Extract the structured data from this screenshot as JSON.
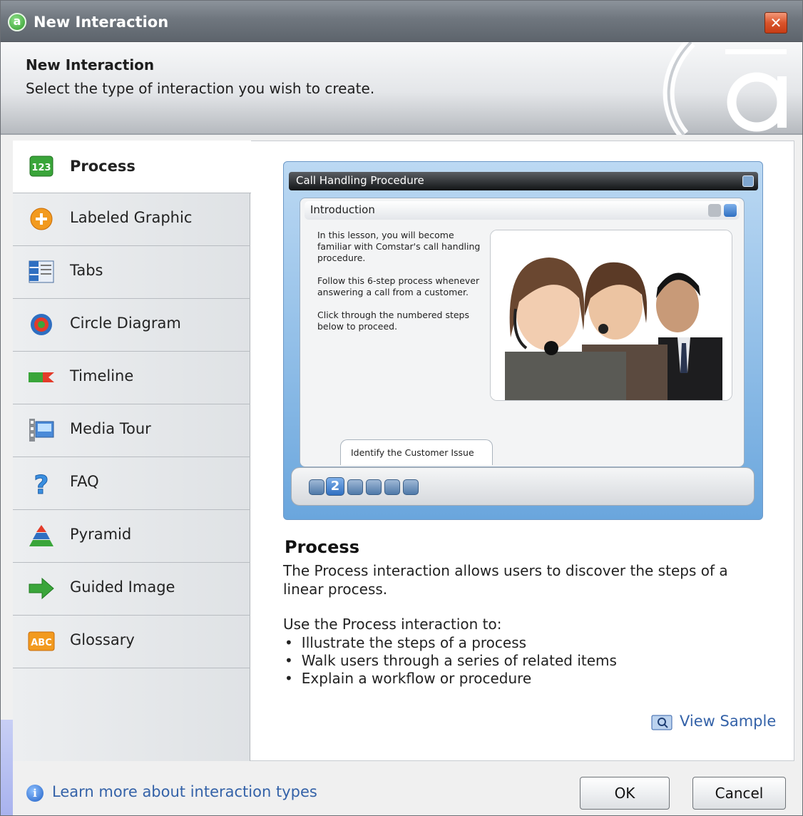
{
  "window": {
    "title": "New Interaction"
  },
  "header": {
    "title": "New Interaction",
    "subtitle": "Select the type of interaction you wish to create."
  },
  "sidebar": {
    "items": [
      {
        "label": "Process",
        "icon": "numbers-123-icon",
        "selected": true
      },
      {
        "label": "Labeled Graphic",
        "icon": "plus-circle-icon"
      },
      {
        "label": "Tabs",
        "icon": "tabs-icon"
      },
      {
        "label": "Circle Diagram",
        "icon": "circle-diagram-icon"
      },
      {
        "label": "Timeline",
        "icon": "timeline-icon"
      },
      {
        "label": "Media Tour",
        "icon": "film-icon"
      },
      {
        "label": "FAQ",
        "icon": "question-icon"
      },
      {
        "label": "Pyramid",
        "icon": "pyramid-icon"
      },
      {
        "label": "Guided Image",
        "icon": "green-arrow-icon"
      },
      {
        "label": "Glossary",
        "icon": "abc-icon"
      }
    ]
  },
  "preview": {
    "window_title": "Call Handling Procedure",
    "panel_title": "Introduction",
    "paragraphs": [
      "In this lesson, you will become familiar with Comstar's call handling procedure.",
      "Follow this 6-step process whenever answering a call from a customer.",
      "Click through the numbered steps below to proceed."
    ],
    "tooltip": "Identify the Customer Issue",
    "current_step": "2"
  },
  "description": {
    "title": "Process",
    "body": "The Process interaction allows users to discover the steps of a linear process.",
    "uses_intro": "Use the Process interaction to:",
    "uses": [
      "Illustrate the steps of a process",
      "Walk users through a series of related items",
      "Explain a workflow or procedure"
    ],
    "view_sample": "View Sample"
  },
  "footer": {
    "learn_more": "Learn more about interaction types",
    "ok": "OK",
    "cancel": "Cancel"
  },
  "colors": {
    "link": "#3462a8",
    "accent_green": "#2f9b2a",
    "preview_blue": "#6aa6dd"
  }
}
